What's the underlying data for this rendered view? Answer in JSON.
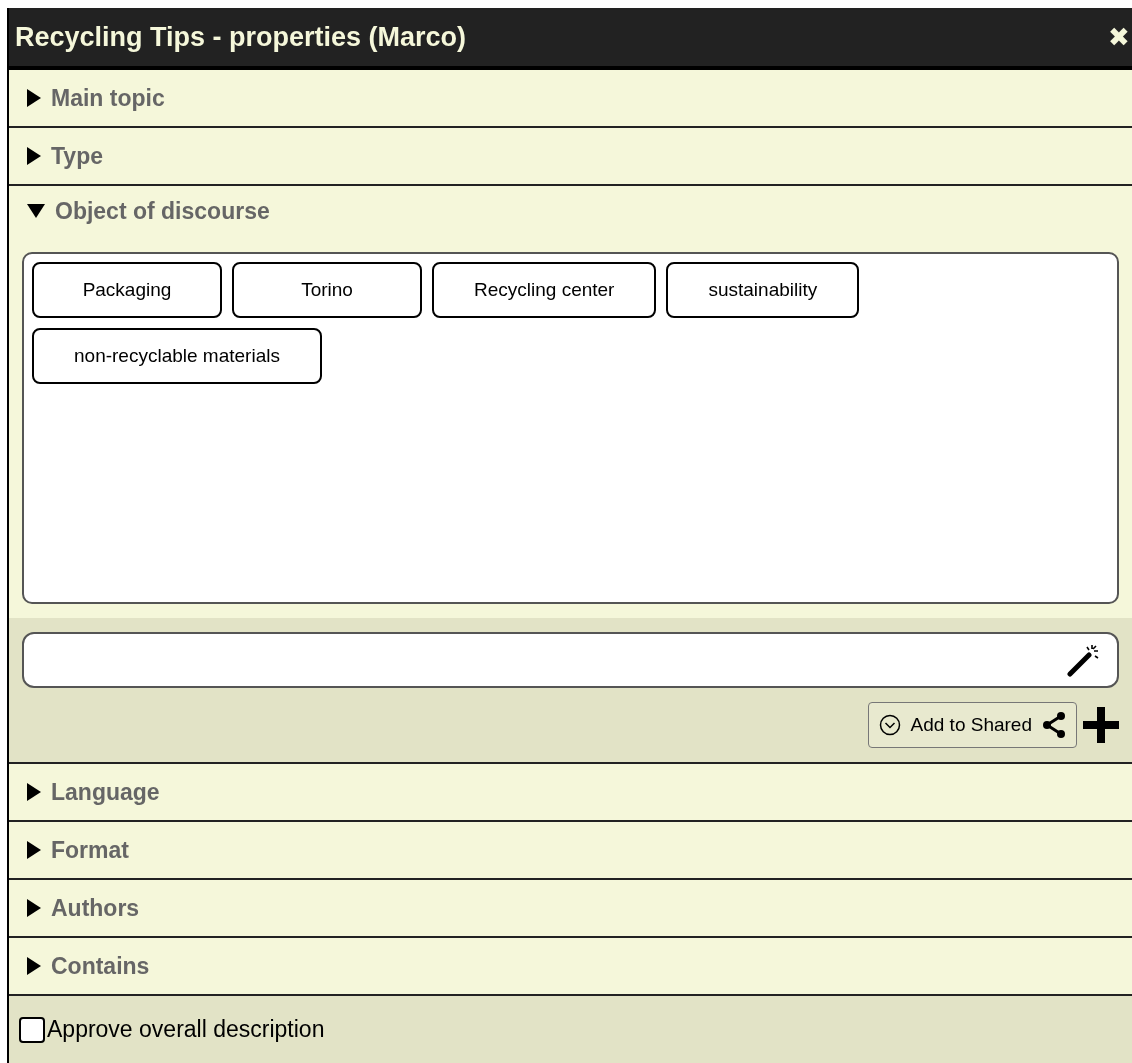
{
  "window": {
    "title": "Recycling Tips - properties (Marco)",
    "close": "✖"
  },
  "sections": [
    {
      "label": "Main topic",
      "expanded": false
    },
    {
      "label": "Type",
      "expanded": false
    },
    {
      "label": "Object of discourse",
      "expanded": true,
      "tags": [
        "Packaging",
        "Torino",
        "Recycling center",
        "sustainability",
        "non-recyclable materials"
      ],
      "add_button": "Add to Shared"
    },
    {
      "label": "Language",
      "expanded": false
    },
    {
      "label": "Format",
      "expanded": false
    },
    {
      "label": "Authors",
      "expanded": false
    },
    {
      "label": "Contains",
      "expanded": false
    }
  ],
  "footer": {
    "label": "Approve overall description",
    "checked": false
  }
}
